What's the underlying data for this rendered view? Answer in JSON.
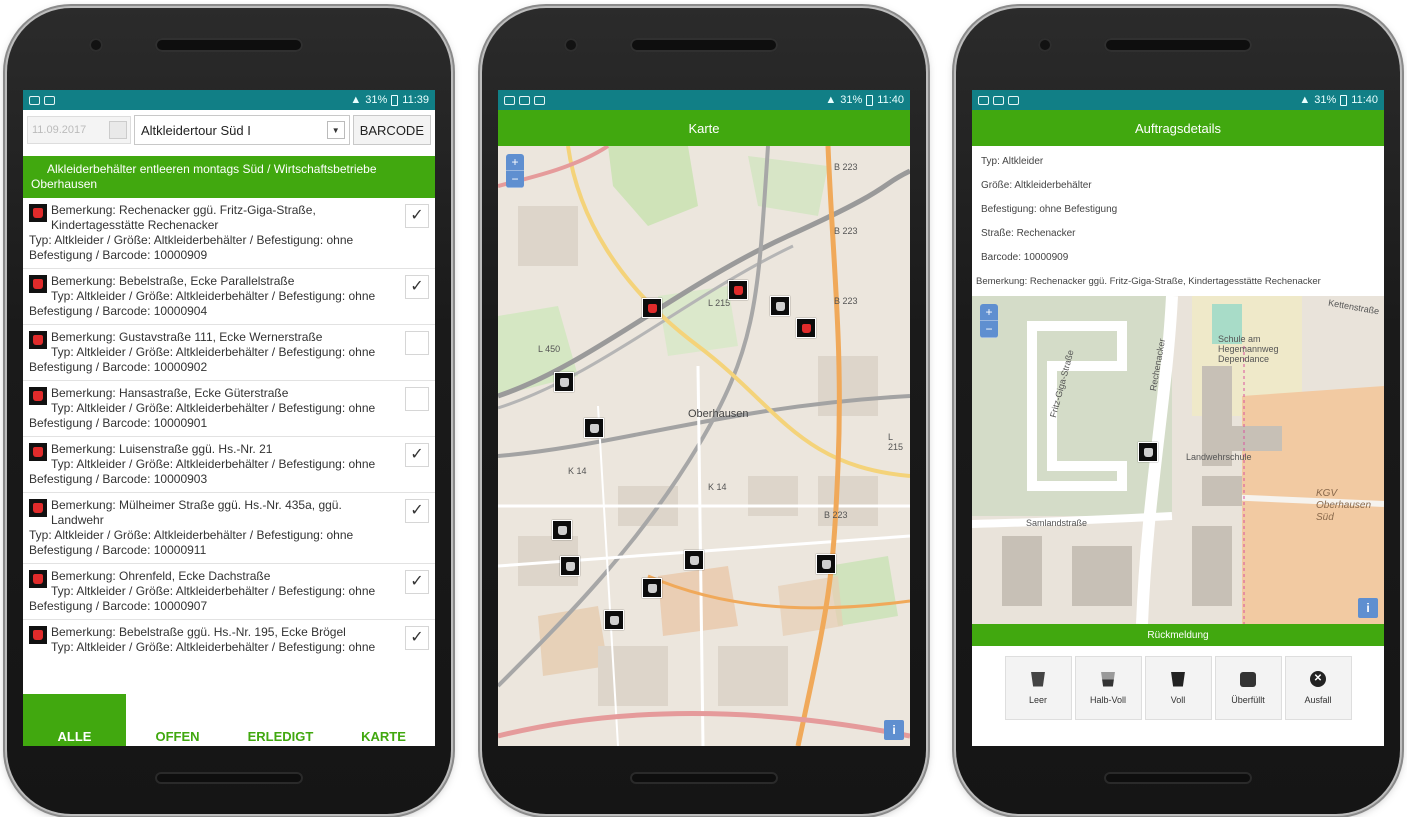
{
  "status_bars": [
    {
      "signal": "31%",
      "time": "11:39"
    },
    {
      "signal": "31%",
      "time": "11:40"
    },
    {
      "signal": "31%",
      "time": "11:40"
    }
  ],
  "list_screen": {
    "date_placeholder": "11.09.2017",
    "tour_select": "Altkleidertour Süd I",
    "barcode_button": "BARCODE",
    "group_header": "Alkleiderbehälter entleeren montags Süd / Wirtschaftsbetriebe Oberhausen",
    "items": [
      {
        "remark": "Bemerkung: Rechenacker ggü. Fritz-Giga-Straße, Kindertagesstätte Rechenacker",
        "details": "Typ: Altkleider / Größe: Altkleiderbehälter / Befestigung: ohne Befestigung / Barcode: 10000909",
        "checked": true
      },
      {
        "remark": "Bemerkung: Bebelstraße, Ecke Parallelstraße",
        "details": "Typ: Altkleider / Größe: Altkleiderbehälter / Befestigung: ohne Befestigung / Barcode: 10000904",
        "checked": true
      },
      {
        "remark": "Bemerkung: Gustavstraße 111, Ecke Wernerstraße",
        "details": "Typ: Altkleider / Größe: Altkleiderbehälter / Befestigung: ohne Befestigung / Barcode: 10000902",
        "checked": false
      },
      {
        "remark": "Bemerkung: Hansastraße, Ecke Güterstraße",
        "details": "Typ: Altkleider / Größe: Altkleiderbehälter / Befestigung: ohne Befestigung / Barcode: 10000901",
        "checked": false
      },
      {
        "remark": "Bemerkung: Luisenstraße ggü. Hs.-Nr. 21",
        "details": "Typ: Altkleider / Größe: Altkleiderbehälter / Befestigung: ohne Befestigung / Barcode: 10000903",
        "checked": true
      },
      {
        "remark": "Bemerkung: Mülheimer Straße ggü. Hs.-Nr. 435a, ggü. Landwehr",
        "details": "Typ: Altkleider / Größe: Altkleiderbehälter / Befestigung: ohne Befestigung / Barcode: 10000911",
        "checked": true
      },
      {
        "remark": "Bemerkung: Ohrenfeld, Ecke Dachstraße",
        "details": "Typ: Altkleider / Größe: Altkleiderbehälter / Befestigung: ohne Befestigung / Barcode: 10000907",
        "checked": true
      },
      {
        "remark": "Bemerkung: Bebelstraße ggü. Hs.-Nr. 195, Ecke Brögel",
        "details": "Typ: Altkleider / Größe: Altkleiderbehälter / Befestigung: ohne Befestigung",
        "checked": true
      }
    ],
    "tabs": [
      "ALLE",
      "OFFEN",
      "ERLEDIGT",
      "KARTE"
    ],
    "active_tab": "ALLE"
  },
  "map_screen": {
    "title": "Karte",
    "city_label": "Oberhausen",
    "zoom_in": "+",
    "zoom_out": "−",
    "info": "i",
    "road_labels": [
      "B 223",
      "B 223",
      "B 223",
      "L 215",
      "L 215",
      "K 14",
      "K 14",
      "B 223",
      "L 450"
    ]
  },
  "detail_screen": {
    "title": "Auftragsdetails",
    "fields": [
      "Typ: Altkleider",
      "Größe: Altkleiderbehälter",
      "Befestigung: ohne Befestigung",
      "Straße: Rechenacker",
      "Barcode: 10000909",
      "Bemerkung: Rechenacker ggü. Fritz-Giga-Straße, Kindertagesstätte Rechenacker"
    ],
    "map_labels": {
      "school": "Schule am Hegemannweg Dependance",
      "landwehr_school": "Landwehrschule",
      "kgv": "KGV Oberhausen Süd",
      "samland": "Samlandstraße",
      "rechenacker": "Rechenacker",
      "fritz": "Fritz-Giga-Straße",
      "ketten": "Kettenstraße"
    },
    "feedback_header": "Rückmeldung",
    "feedback_buttons": [
      "Leer",
      "Halb-Voll",
      "Voll",
      "Überfüllt",
      "Ausfall"
    ]
  }
}
